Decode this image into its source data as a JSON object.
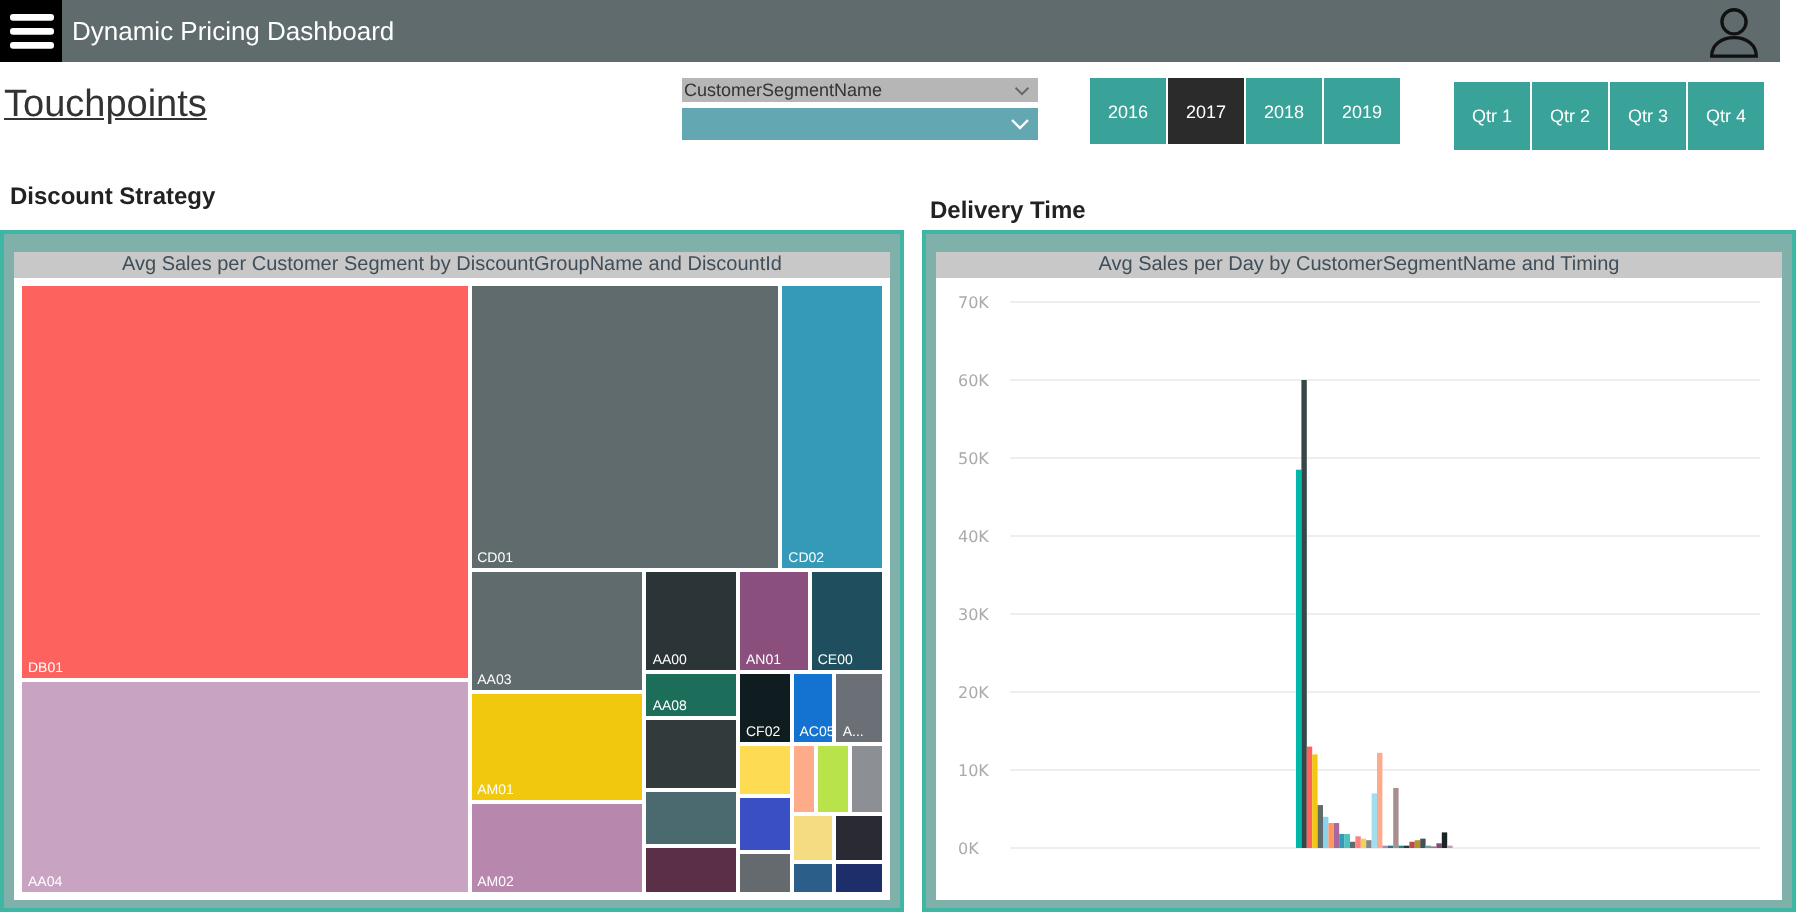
{
  "header": {
    "title": "Dynamic Pricing Dashboard"
  },
  "page_title": "Touchpoints",
  "filters": {
    "segment_dropdown": {
      "label": "CustomerSegmentName"
    }
  },
  "years": [
    {
      "label": "2016",
      "selected": false
    },
    {
      "label": "2017",
      "selected": true
    },
    {
      "label": "2018",
      "selected": false
    },
    {
      "label": "2019",
      "selected": false
    }
  ],
  "quarters": [
    {
      "label": "Qtr 1",
      "selected": false
    },
    {
      "label": "Qtr 2",
      "selected": false
    },
    {
      "label": "Qtr 3",
      "selected": false
    },
    {
      "label": "Qtr 4",
      "selected": false
    }
  ],
  "discount_strategy": {
    "heading": "Discount Strategy",
    "visual_title": "Avg Sales per Customer Segment by DiscountGroupName and DiscountId",
    "tiles": [
      {
        "label": "DB01",
        "color": "#fd625e"
      },
      {
        "label": "AA04",
        "color": "#c8a3c2"
      },
      {
        "label": "CD01",
        "color": "#5f6b6d"
      },
      {
        "label": "CD02",
        "color": "#3599b8"
      },
      {
        "label": "AA03",
        "color": "#5f6b6d"
      },
      {
        "label": "AA00",
        "color": "#2b3436"
      },
      {
        "label": "AN01",
        "color": "#8a4f7d"
      },
      {
        "label": "CE00",
        "color": "#1f4e5f"
      },
      {
        "label": "AM01",
        "color": "#f2c80f"
      },
      {
        "label": "AM02",
        "color": "#b887ad"
      },
      {
        "label": "AA08",
        "color": "#1c6e5a"
      },
      {
        "label": "CF02",
        "color": "#0f1c20"
      },
      {
        "label": "AC05",
        "color": "#1473d0"
      },
      {
        "label": "A...",
        "color": "#6b6f76"
      },
      {
        "color": "#333a3c"
      },
      {
        "color": "#4a6a70"
      },
      {
        "color": "#5b2f48"
      },
      {
        "color": "#fddc53"
      },
      {
        "color": "#fdab89"
      },
      {
        "color": "#b8e34a"
      },
      {
        "color": "#8c9094"
      },
      {
        "color": "#3b4fc4"
      },
      {
        "color": "#656a6e"
      },
      {
        "color": "#f5dc80"
      },
      {
        "color": "#2a2a35"
      },
      {
        "color": "#2b5f8a"
      },
      {
        "color": "#1d2f6b"
      }
    ]
  },
  "delivery_time": {
    "heading": "Delivery Time",
    "visual_title": "Avg Sales per Day by CustomerSegmentName and Timing",
    "chart_data": {
      "type": "bar",
      "grid": true,
      "ylim": [
        0,
        70000
      ],
      "yticks": [
        {
          "value": 0,
          "label": "0K"
        },
        {
          "value": 10000,
          "label": "10K"
        },
        {
          "value": 20000,
          "label": "20K"
        },
        {
          "value": 30000,
          "label": "30K"
        },
        {
          "value": 40000,
          "label": "40K"
        },
        {
          "value": 50000,
          "label": "50K"
        },
        {
          "value": 60000,
          "label": "60K"
        },
        {
          "value": 70000,
          "label": "70K"
        }
      ],
      "series": [
        {
          "color": "#01b8aa",
          "values": [
            48500
          ]
        },
        {
          "color": "#374649",
          "values": [
            60000
          ]
        },
        {
          "color": "#fd625e",
          "values": [
            13000
          ]
        },
        {
          "color": "#f2c80f",
          "values": [
            12000
          ]
        },
        {
          "color": "#5f6b6d",
          "values": [
            5500
          ]
        },
        {
          "color": "#8ad4eb",
          "values": [
            4000
          ]
        },
        {
          "color": "#fe9666",
          "values": [
            3200
          ]
        },
        {
          "color": "#a66999",
          "values": [
            3200
          ]
        },
        {
          "color": "#3599b8",
          "values": [
            1800
          ]
        },
        {
          "color": "#4ac5bb",
          "values": [
            1800
          ]
        },
        {
          "color": "#5f6b6d",
          "values": [
            800
          ]
        },
        {
          "color": "#fb8281",
          "values": [
            1500
          ]
        },
        {
          "color": "#f4d25a",
          "values": [
            1200
          ]
        },
        {
          "color": "#7f898a",
          "values": [
            1000
          ]
        },
        {
          "color": "#a4ddee",
          "values": [
            7000
          ]
        },
        {
          "color": "#fdab89",
          "values": [
            12200
          ]
        },
        {
          "color": "#b687ac",
          "values": [
            300
          ]
        },
        {
          "color": "#28738a",
          "values": [
            300
          ]
        },
        {
          "color": "#a78f8f",
          "values": [
            7700
          ]
        },
        {
          "color": "#168980",
          "values": [
            300
          ]
        },
        {
          "color": "#293537",
          "values": [
            300
          ]
        },
        {
          "color": "#bb4a4a",
          "values": [
            800
          ]
        },
        {
          "color": "#b59525",
          "values": [
            1000
          ]
        },
        {
          "color": "#475052",
          "values": [
            1200
          ]
        },
        {
          "color": "#6a9fb0",
          "values": [
            300
          ]
        },
        {
          "color": "#bd7150",
          "values": [
            200
          ]
        },
        {
          "color": "#7b4f71",
          "values": [
            600
          ]
        },
        {
          "color": "#1c2325",
          "values": [
            2000
          ]
        },
        {
          "color": "#bf9ab5",
          "values": [
            300
          ]
        }
      ]
    }
  }
}
